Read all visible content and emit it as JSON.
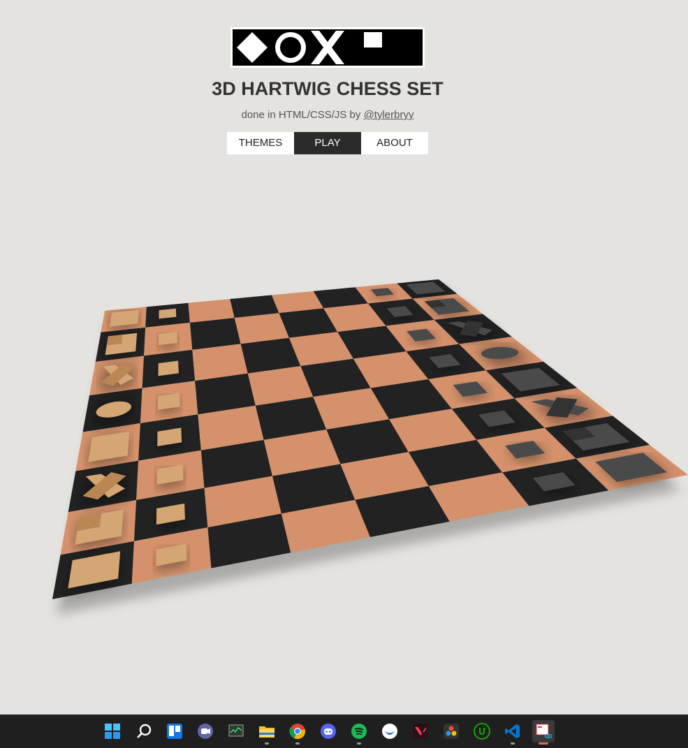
{
  "header": {
    "title": "3D HARTWIG CHESS SET",
    "subtitle_prefix": "done in HTML/CSS/JS by ",
    "author_link": "@tylerbryy"
  },
  "nav": {
    "items": [
      {
        "label": "THEMES",
        "active": false
      },
      {
        "label": "PLAY",
        "active": true
      },
      {
        "label": "ABOUT",
        "active": false
      }
    ]
  },
  "colors": {
    "background": "#e5e3df",
    "light_square": "#d4916b",
    "dark_square": "#222222",
    "light_piece": "#d3a674",
    "dark_piece": "#4a4a4a",
    "nav_active": "#2b2b2b"
  },
  "board": {
    "files": 8,
    "ranks": 8,
    "light_pieces": [
      "rook",
      "knight",
      "bishop",
      "queen",
      "king",
      "bishop",
      "knight",
      "rook",
      "pawn",
      "pawn",
      "pawn",
      "pawn",
      "pawn",
      "pawn",
      "pawn",
      "pawn"
    ],
    "dark_pieces": [
      "rook",
      "knight",
      "bishop",
      "queen",
      "king",
      "bishop",
      "knight",
      "rook",
      "pawn",
      "pawn",
      "pawn",
      "pawn",
      "pawn",
      "pawn",
      "pawn",
      "pawn"
    ]
  },
  "taskbar": {
    "icons": [
      "windows-start-icon",
      "search-icon",
      "trello-icon",
      "teams-chat-icon",
      "task-monitor-icon",
      "file-explorer-icon",
      "chrome-icon",
      "discord-icon",
      "spotify-icon",
      "bereal-icon",
      "valorant-icon",
      "davinci-resolve-icon",
      "upwork-icon",
      "vscode-icon",
      "snipping-tool-icon"
    ]
  }
}
